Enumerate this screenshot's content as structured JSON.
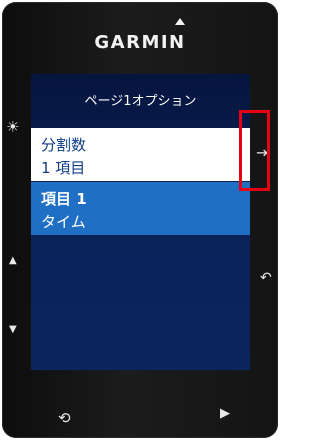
{
  "device": {
    "brand": "GARMIN"
  },
  "screen": {
    "title": "ページ1オプション",
    "items": [
      {
        "line1": "分割数",
        "line2": "1 項目",
        "selected": false
      },
      {
        "line1": "項目 1",
        "line2": "タイム",
        "selected": true
      }
    ]
  },
  "icons": {
    "brightness": "☀",
    "up": "▲",
    "down": "▼",
    "enter": "⇥",
    "back": "↶",
    "lap": "⟲",
    "start_stop": "▶"
  },
  "colors": {
    "highlight": "#e60012",
    "selected_row": "#1f6fc5",
    "screen_bg": "#0a2158"
  }
}
